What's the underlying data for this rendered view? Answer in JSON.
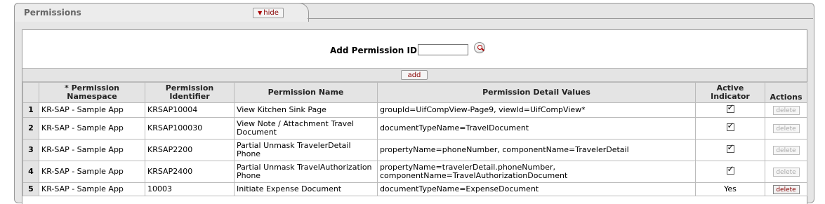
{
  "tab": {
    "title": "Permissions",
    "hide_label": "hide"
  },
  "add_section": {
    "label": "Add Permission ID:",
    "input_value": "",
    "add_label": "add"
  },
  "table": {
    "headers": {
      "namespace": "* Permission Namespace",
      "identifier": "Permission Identifier",
      "name": "Permission Name",
      "details": "Permission Detail Values",
      "active": "Active Indicator",
      "actions": "Actions"
    },
    "rows": [
      {
        "num": "1",
        "namespace": "KR-SAP - Sample App",
        "identifier": "KRSAP10004",
        "name": "View Kitchen Sink Page",
        "details": "groupId=UifCompView-Page9, viewId=UifCompView*",
        "active": "checked",
        "action": "delete"
      },
      {
        "num": "2",
        "namespace": "KR-SAP - Sample App",
        "identifier": "KRSAP100030",
        "name": "View Note / Attachment Travel Document",
        "details": "documentTypeName=TravelDocument",
        "active": "checked",
        "action": "delete"
      },
      {
        "num": "3",
        "namespace": "KR-SAP - Sample App",
        "identifier": "KRSAP2200",
        "name": "Partial Unmask TravelerDetail Phone",
        "details": "propertyName=phoneNumber, componentName=TravelerDetail",
        "active": "checked",
        "action": "delete"
      },
      {
        "num": "4",
        "namespace": "KR-SAP - Sample App",
        "identifier": "KRSAP2400",
        "name": "Partial Unmask TravelAuthorization Phone",
        "details": "propertyName=travelerDetail.phoneNumber, componentName=TravelAuthorizationDocument",
        "active": "checked",
        "action": "delete"
      },
      {
        "num": "5",
        "namespace": "KR-SAP - Sample App",
        "identifier": "10003",
        "name": "Initiate Expense Document",
        "details": "documentTypeName=ExpenseDocument",
        "active": "Yes",
        "action": "delete"
      }
    ]
  }
}
